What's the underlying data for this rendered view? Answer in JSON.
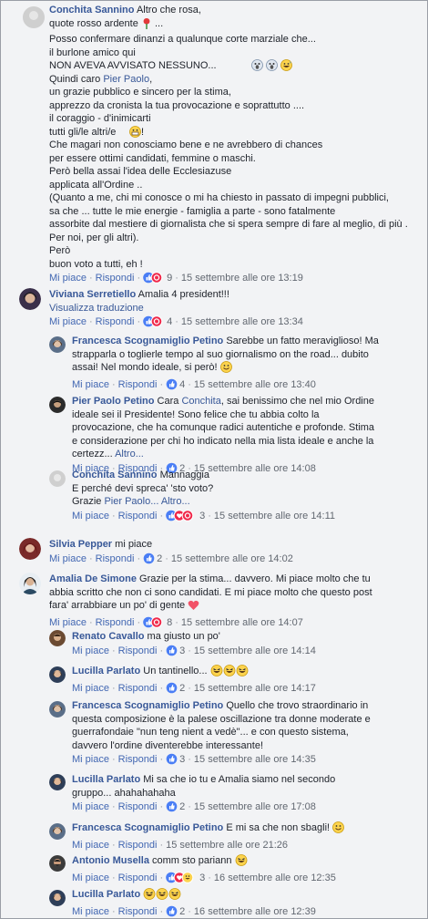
{
  "comments": [
    {
      "author": "Conchita Sannino",
      "first_line": "Altro che rosa,",
      "lines_a": "quote rosso ardente",
      "lines_b": "Posso confermare dinanzi a qualunque corte marziale che...\nil burlone amico qui\nNON AVEVA AVVISATO NESSUNO...",
      "line_c": "Quindi caro ",
      "mention": "Pier Paolo",
      "line_c_end": ",",
      "lines_d": "un grazie pubblico e sincero per la stima,\napprezzo da cronista la tua provocazione e soprattutto ....\nil coraggio - d'inimicarti\ntutti gli/le altri/e",
      "lines_e": "Che magari non conosciamo bene e ne avrebbero di chances\nper essere ottimi candidati, femmine o maschi.\nPerò bella assai l'idea delle Ecclesiazuse\napplicata all'Ordine ..\n(Quanto a me, chi mi conosce o mi ha chiesto in passato di impegni pubblici,\nsa che ... tutte le mie energie - famiglia a parte - sono fatalmente\nassorbite dal mestiere di giornalista che si spera sempre di fare al meglio, di più .\nPer noi, per gli altri).\nPerò\nbuon voto a tutti, eh !",
      "like": "Mi piace",
      "reply": "Rispondi",
      "reactions": "9",
      "date": "15 settembre alle ore 13:19"
    },
    {
      "author": "Viviana Serretiello",
      "text": "Amalia 4 president!!!",
      "translate": "Visualizza traduzione",
      "like": "Mi piace",
      "reply": "Rispondi",
      "reactions": "4",
      "date": "15 settembre alle ore 13:34"
    },
    {
      "author": "Francesca Scognamiglio Petino",
      "text": "Sarebbe un fatto meraviglioso! Ma strapparla o toglierle tempo al suo giornalismo on the road... dubito assai! Nel mondo ideale, si però!",
      "like": "Mi piace",
      "reply": "Rispondi",
      "reactions": "4",
      "date": "15 settembre alle ore 13:40"
    },
    {
      "author": "Pier Paolo Petino",
      "text_a": "Cara ",
      "mention": "Conchita",
      "text_b": ", sai benissimo che nel mio Ordine ideale sei il Presidente! Sono felice che tu abbia colto la provocazione, che ha comunque radici autentiche e profonde. Stima e considerazione per chi ho indicato nella mia lista ideale e anche la certezz...",
      "more": "Altro...",
      "like": "Mi piace",
      "reply": "Rispondi",
      "reactions": "2",
      "date": "15 settembre alle ore 14:08"
    },
    {
      "author": "Conchita Sannino",
      "text_a": "Mannaggia",
      "text_b": "E perché devi spreca' 'sto voto?",
      "text_c": "Grazie ",
      "mention": "Pier Paolo...",
      "more": "Altro...",
      "like": "Mi piace",
      "reply": "Rispondi",
      "reactions": "3",
      "date": "15 settembre alle ore 14:11"
    },
    {
      "author": "Silvia Pepper",
      "text": "mi piace",
      "like": "Mi piace",
      "reply": "Rispondi",
      "reactions": "2",
      "date": "15 settembre alle ore 14:02"
    },
    {
      "author": "Amalia De Simone",
      "text": "Grazie per la stima... davvero. Mi piace molto che tu abbia scritto che non ci sono candidati. E mi piace molto che questo post fara' arrabbiare un po' di gente",
      "like": "Mi piace",
      "reply": "Rispondi",
      "reactions": "8",
      "date": "15 settembre alle ore 14:07"
    },
    {
      "author": "Renato Cavallo",
      "text": "ma giusto un po'",
      "like": "Mi piace",
      "reply": "Rispondi",
      "reactions": "3",
      "date": "15 settembre alle ore 14:14"
    },
    {
      "author": "Lucilla Parlato",
      "text": "Un tantinello...",
      "like": "Mi piace",
      "reply": "Rispondi",
      "reactions": "2",
      "date": "15 settembre alle ore 14:17"
    },
    {
      "author": "Francesca Scognamiglio Petino",
      "text": "Quello che trovo straordinario in questa composizione è la palese oscillazione tra donne moderate e guerrafondaie \"nun teng nient a vedè\"... e con questo sistema, davvero l'ordine diventerebbe interessante!",
      "like": "Mi piace",
      "reply": "Rispondi",
      "reactions": "3",
      "date": "15 settembre alle ore 14:35"
    },
    {
      "author": "Lucilla Parlato",
      "text": "Mi sa che io tu e Amalia siamo nel secondo gruppo... ahahahahaha",
      "like": "Mi piace",
      "reply": "Rispondi",
      "reactions": "2",
      "date": "15 settembre alle ore 17:08"
    },
    {
      "author": "Francesca Scognamiglio Petino",
      "text": "E mi sa che non sbagli!",
      "like": "Mi piace",
      "reply": "Rispondi",
      "date": "15 settembre alle ore 21:26"
    },
    {
      "author": "Antonio Musella",
      "text": "comm sto pariann",
      "like": "Mi piace",
      "reply": "Rispondi",
      "reactions": "3",
      "date": "16 settembre alle ore 12:35"
    },
    {
      "author": "Lucilla Parlato",
      "like": "Mi piace",
      "reply": "Rispondi",
      "reactions": "2",
      "date": "16 settembre alle ore 12:39"
    }
  ],
  "colors": {
    "link": "#385898",
    "action": "#4267b2",
    "meta": "#616770",
    "like_blue": "#4a7ef5",
    "love_red": "#f0284a",
    "haha_yellow": "#fcd34d"
  }
}
